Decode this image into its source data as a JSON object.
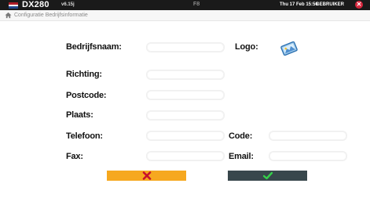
{
  "topbar": {
    "app_title": "DX280",
    "version": "v6.15j",
    "function_label": "F8",
    "datetime": "Thu 17 Feb 15:56",
    "user": "GEBRUIKER",
    "flag_colors": [
      "#ae1c28",
      "#ffffff",
      "#21468b"
    ],
    "close_icon": "close-icon"
  },
  "breadcrumb": {
    "home_icon": "home-icon",
    "text": "Configuratie Bedrijfsinformatie"
  },
  "form": {
    "company_name_label": "Bedrijfsnaam:",
    "logo_label": "Logo:",
    "direction_label": "Richting:",
    "postcode_label": "Postcode:",
    "city_label": "Plaats:",
    "phone_label": "Telefoon:",
    "code_label": "Code:",
    "fax_label": "Fax:",
    "email_label": "Email:",
    "company_name_value": "",
    "direction_value": "",
    "postcode_value": "",
    "city_value": "",
    "phone_value": "",
    "code_value": "",
    "fax_value": "",
    "email_value": ""
  },
  "buttons": {
    "cancel_icon": "x-icon",
    "confirm_icon": "checkmark-icon",
    "cancel_color": "#f6a81f",
    "confirm_color": "#38474c"
  }
}
